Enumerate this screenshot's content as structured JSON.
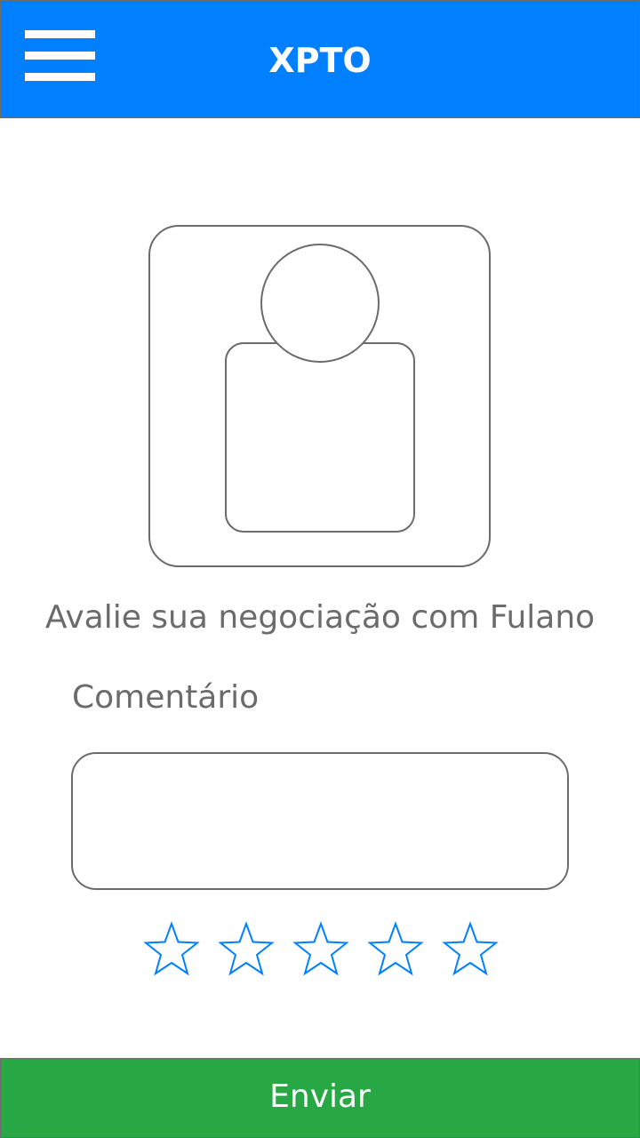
{
  "header": {
    "title": "XPTO",
    "menu_icon": "hamburger-menu-icon",
    "background_color": "#0080ff"
  },
  "profile": {
    "avatar_icon": "user-avatar-icon"
  },
  "rating": {
    "prompt": "Avalie sua negociação com Fulano",
    "comment_label": "Comentário",
    "comment_value": "",
    "stars_total": 5,
    "stars_selected": 0,
    "star_icon": "star-outline-icon",
    "star_color": "#0080ff"
  },
  "footer": {
    "submit_label": "Enviar",
    "background_color": "#28a745"
  }
}
